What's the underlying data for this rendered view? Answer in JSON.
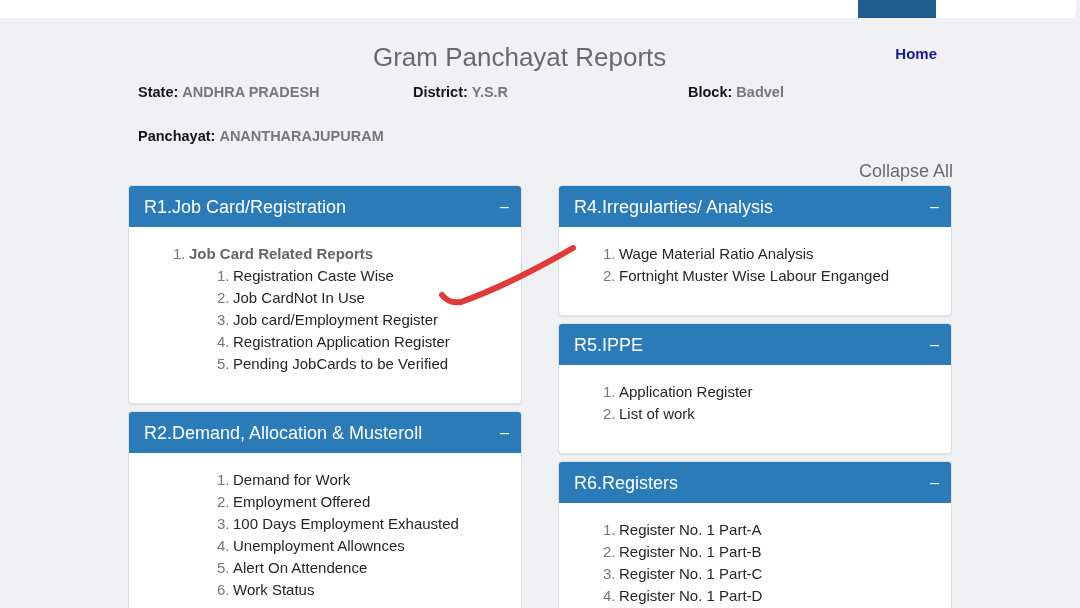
{
  "page": {
    "title": "Gram Panchayat Reports",
    "home_link": "Home"
  },
  "location": [
    {
      "label": "State:",
      "value": "ANDHRA PRADESH"
    },
    {
      "label": "District:",
      "value": "Y.S.R"
    },
    {
      "label": "Block:",
      "value": "Badvel"
    },
    {
      "label": "Panchayat:",
      "value": "ANANTHARAJUPURAM"
    }
  ],
  "collapse_all": "Collapse All",
  "columns": [
    {
      "panels": [
        {
          "title": "R1.Job Card/Registration",
          "toggle": "–",
          "expanded": true,
          "items": [
            {
              "number": "1.",
              "label": "Job Card Related Reports",
              "children": [
                {
                  "number": "1.",
                  "label": "Registration Caste Wise"
                },
                {
                  "number": "2.",
                  "label": "Job CardNot In Use"
                },
                {
                  "number": "3.",
                  "label": "Job card/Employment Register"
                },
                {
                  "number": "4.",
                  "label": "Registration Application Register"
                },
                {
                  "number": "5.",
                  "label": "Pending JobCards to be Verified"
                }
              ]
            }
          ]
        },
        {
          "title": "R2.Demand, Allocation & Musteroll",
          "toggle": "–",
          "expanded": true,
          "items": [
            {
              "children": [
                {
                  "number": "1.",
                  "label": "Demand for Work"
                },
                {
                  "number": "2.",
                  "label": "Employment Offered"
                },
                {
                  "number": "3.",
                  "label": "100 Days Employment Exhausted"
                },
                {
                  "number": "4.",
                  "label": "Unemployment Allownces"
                },
                {
                  "number": "5.",
                  "label": "Alert On Attendence"
                },
                {
                  "number": "6.",
                  "label": "Work Status"
                }
              ]
            }
          ]
        }
      ]
    },
    {
      "panels": [
        {
          "title": "R4.Irregularties/ Analysis",
          "toggle": "–",
          "expanded": true,
          "items": [
            {
              "number": "1.",
              "label": "Wage Material Ratio Analysis"
            },
            {
              "number": "2.",
              "label": "Fortnight Muster Wise Labour Enganged"
            }
          ]
        },
        {
          "title": "R5.IPPE",
          "toggle": "–",
          "expanded": true,
          "items": [
            {
              "number": "1.",
              "label": "Application Register"
            },
            {
              "number": "2.",
              "label": "List of work"
            }
          ]
        },
        {
          "title": "R6.Registers",
          "toggle": "–",
          "expanded": true,
          "items": [
            {
              "number": "1.",
              "label": "Register No. 1 Part-A"
            },
            {
              "number": "2.",
              "label": "Register No. 1 Part-B"
            },
            {
              "number": "3.",
              "label": "Register No. 1 Part-C"
            },
            {
              "number": "4.",
              "label": "Register No. 1 Part-D"
            }
          ]
        }
      ]
    }
  ],
  "annotations": [
    {
      "kind": "stroke"
    }
  ]
}
